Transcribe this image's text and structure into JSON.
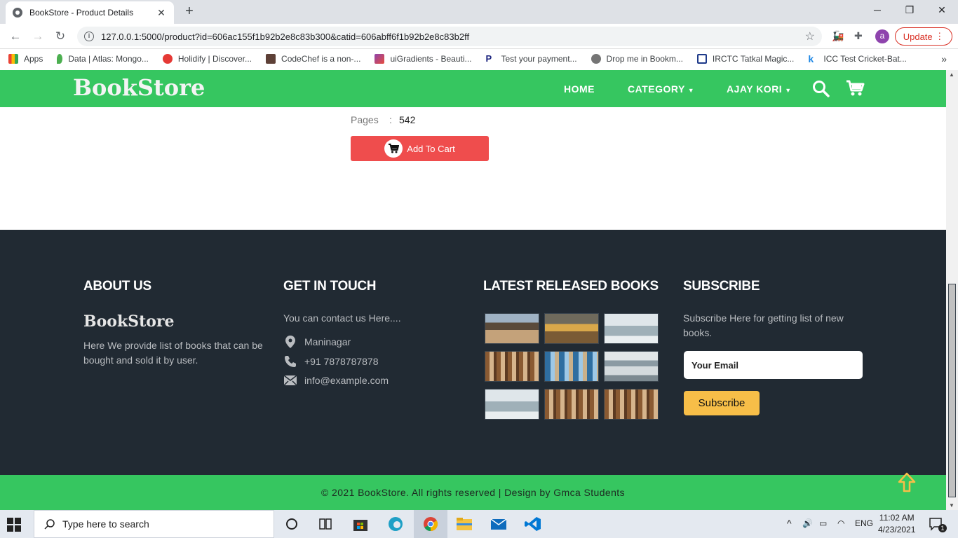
{
  "browser": {
    "tab_title": "BookStore - Product Details",
    "tab_close": "✕",
    "new_tab": "+",
    "url": "127.0.0.1:5000/product?id=606ac155f1b92b2e8c83b300&catid=606abff6f1b92b2e8c83b2ff",
    "profile_initial": "a",
    "update_label": "Update",
    "bookmarks": [
      {
        "label": "Apps",
        "color": "#ea4335"
      },
      {
        "label": "Data | Atlas: Mongo...",
        "color": "#4caf50"
      },
      {
        "label": "Holidify | Discover...",
        "color": "#e53935"
      },
      {
        "label": "CodeChef is a non-...",
        "color": "#5d4037"
      },
      {
        "label": "uiGradients - Beauti...",
        "color": "#8e44ad"
      },
      {
        "label": "Test your payment...",
        "color": "#1a237e"
      },
      {
        "label": "Drop me in Bookm...",
        "color": "#757575"
      },
      {
        "label": "IRCTC Tatkal Magic...",
        "color": "#1e3a8a"
      },
      {
        "label": "ICC Test Cricket-Bat...",
        "color": "#1e88e5"
      }
    ],
    "bookmarks_more": "»"
  },
  "site": {
    "brand": "BookStore",
    "colors": {
      "primary": "#36c660",
      "footer": "#212a33",
      "cart_button": "#ef4d4d",
      "subscribe": "#f7be48"
    },
    "nav": {
      "home": "HOME",
      "category": "CATEGORY",
      "user": "AJAY KORI"
    },
    "product": {
      "pages_label": "Pages",
      "pages_sep": ":",
      "pages_value": "542",
      "add_to_cart": "Add To Cart"
    },
    "footer": {
      "about": {
        "heading": "ABOUT US",
        "brand": "BookStore",
        "text": "Here We provide list of books that can be bought and sold it by user."
      },
      "contact": {
        "heading": "GET IN TOUCH",
        "intro": "You can contact us Here....",
        "address": "Maninagar",
        "phone": "+91 7878787878",
        "email": "info@example.com"
      },
      "latest": {
        "heading": "LATEST RELEASED BOOKS"
      },
      "subscribe": {
        "heading": "SUBSCRIBE",
        "text": "Subscribe Here for getting list of new books.",
        "email_placeholder": "Your Email",
        "button": "Subscribe"
      }
    },
    "copyright": "© 2021 BookStore. All rights reserved | Design by Gmca Students"
  },
  "taskbar": {
    "search_placeholder": "Type here to search",
    "language": "ENG",
    "time": "11:02 AM",
    "date": "4/23/2021",
    "notifications": "1"
  }
}
